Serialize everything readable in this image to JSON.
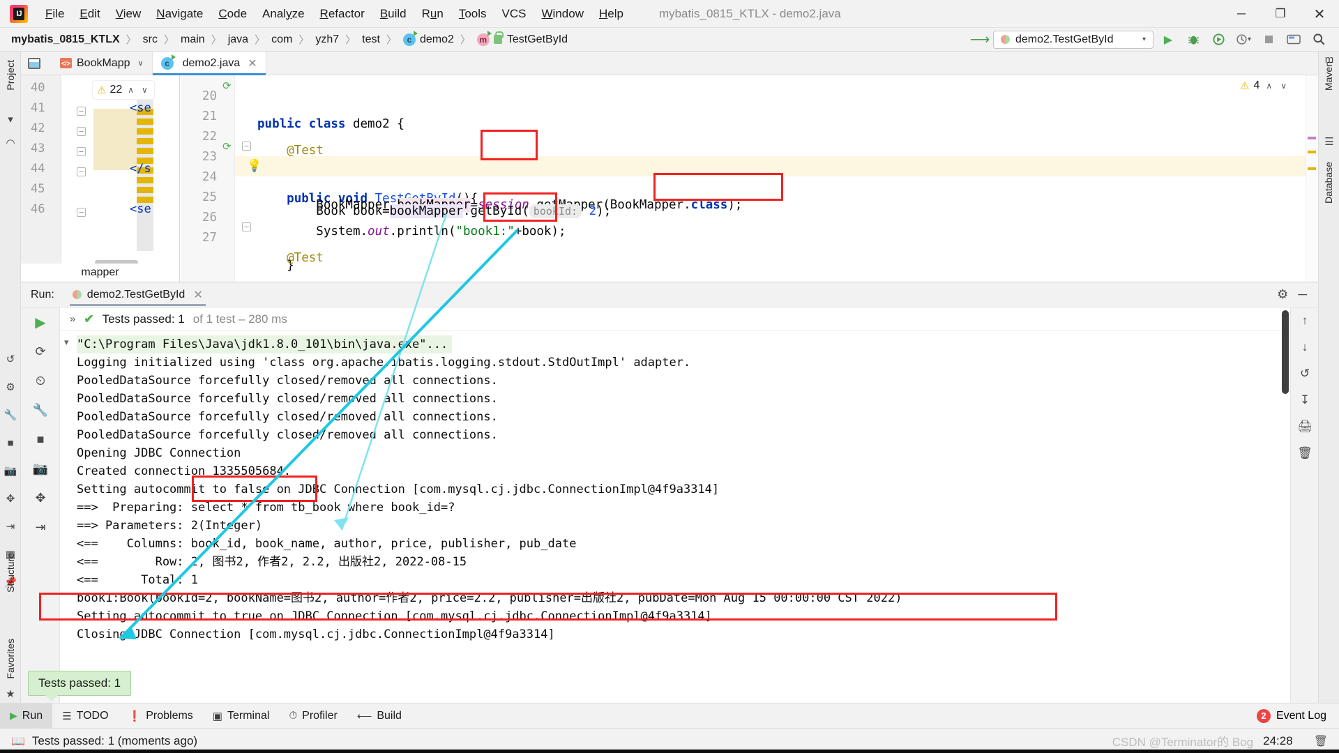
{
  "window": {
    "title": "mybatis_0815_KTLX - demo2.java",
    "minimize": "─",
    "maximize": "❐",
    "close": "✕"
  },
  "menu": {
    "items": [
      {
        "pre": "",
        "key": "F",
        "post": "ile"
      },
      {
        "pre": "",
        "key": "E",
        "post": "dit"
      },
      {
        "pre": "",
        "key": "V",
        "post": "iew"
      },
      {
        "pre": "",
        "key": "N",
        "post": "avigate"
      },
      {
        "pre": "",
        "key": "C",
        "post": "ode"
      },
      {
        "pre": "Anal",
        "key": "y",
        "post": "ze"
      },
      {
        "pre": "",
        "key": "R",
        "post": "efactor"
      },
      {
        "pre": "",
        "key": "B",
        "post": "uild"
      },
      {
        "pre": "R",
        "key": "u",
        "post": "n"
      },
      {
        "pre": "",
        "key": "T",
        "post": "ools"
      },
      {
        "pre": "VCS",
        "key": "",
        "post": ""
      },
      {
        "pre": "",
        "key": "W",
        "post": "indow"
      },
      {
        "pre": "",
        "key": "H",
        "post": "elp"
      }
    ]
  },
  "breadcrumb": {
    "items": [
      "mybatis_0815_KTLX",
      "src",
      "main",
      "java",
      "com",
      "yzh7",
      "test",
      "demo2",
      "TestGetById"
    ],
    "separator": "〉",
    "class_glyph": "c",
    "method_glyph": "m"
  },
  "toolbar": {
    "run_config": "demo2.TestGetById",
    "caret": "▾",
    "build_icon": "build-hammer",
    "run_icon": "▶",
    "debug_icon": "debug-bug",
    "coverage_icon": "run-with-coverage",
    "profile_icon": "profile",
    "stop_icon": "stop",
    "updates_icon": "updates",
    "search_icon": "🔍"
  },
  "left_strip": {
    "project_tab": "Project",
    "structure_tab": "Structure",
    "favorites_tab": "Favorites"
  },
  "right_strip": {
    "maven_tab": "Maven",
    "database_tab": "Database"
  },
  "editor": {
    "tabs": [
      {
        "label": "BookMapp",
        "icon": "xml-file-icon",
        "active": false,
        "close": "✕",
        "caret": "∨"
      },
      {
        "label": "demo2.java",
        "icon": "java-class-icon",
        "active": true,
        "close": "✕"
      }
    ],
    "ghost_pane": {
      "warning_count": "22",
      "warning_up": "∧",
      "warning_down": "∨",
      "footer_label": "mapper",
      "lines": [
        {
          "num": "40",
          "code": ""
        },
        {
          "num": "41",
          "code": "<se"
        },
        {
          "num": "42",
          "code": ""
        },
        {
          "num": "43",
          "code": ""
        },
        {
          "num": "44",
          "code": "</s"
        },
        {
          "num": "45",
          "code": ""
        },
        {
          "num": "46",
          "code": "<se"
        }
      ]
    },
    "java_pane": {
      "warning_count": "4",
      "warning_up": "∧",
      "warning_down": "∨",
      "lines": [
        {
          "num": "20",
          "text": "public class demo2 {"
        },
        {
          "num": "21",
          "text": ""
        },
        {
          "num": "22",
          "text": "    @Test"
        },
        {
          "num": "23",
          "text": "    public void TestGetById(){"
        },
        {
          "num": "24",
          "text": "        BookMapper bookMapper=session.getMapper(BookMapper.class);"
        },
        {
          "num": "25",
          "text": "        Book book=bookMapper.getById( bookId: 2);"
        },
        {
          "num": "26",
          "text": "        System.out.println(\"book1:\"+book);"
        },
        {
          "num": "27",
          "text": "    }"
        }
      ],
      "param_hint": "bookId:",
      "string_literal": "\"book1:\""
    }
  },
  "run_window": {
    "label": "Run:",
    "tab_title": "demo2.TestGetById",
    "tab_close": "✕",
    "settings_icon": "gear-icon",
    "hide_icon": "─",
    "test_status": {
      "chevrons": "»",
      "check": "✔",
      "main": "Tests passed: 1",
      "sub": "of 1 test – 280 ms"
    },
    "console_lines": [
      "\"C:\\Program Files\\Java\\jdk1.8.0_101\\bin\\java.exe\"...",
      "Logging initialized using 'class org.apache.ibatis.logging.stdout.StdOutImpl' adapter.",
      "PooledDataSource forcefully closed/removed all connections.",
      "PooledDataSource forcefully closed/removed all connections.",
      "PooledDataSource forcefully closed/removed all connections.",
      "PooledDataSource forcefully closed/removed all connections.",
      "Opening JDBC Connection",
      "Created connection 1335505684.",
      "Setting autocommit to false on JDBC Connection [com.mysql.cj.jdbc.ConnectionImpl@4f9a3314]",
      "==>  Preparing: select * from tb_book where book_id=?",
      "==> Parameters: 2(Integer)",
      "<==    Columns: book_id, book_name, author, price, publisher, pub_date",
      "<==        Row: 2, 图书2, 作者2, 2.2, 出版社2, 2022-08-15",
      "<==      Total: 1",
      "book1:Book(bookId=2, bookName=图书2, author=作者2, price=2.2, publisher=出版社2, pubDate=Mon Aug 15 00:00:00 CST 2022)",
      "Setting autocommit to true on JDBC Connection [com.mysql.cj.jdbc.ConnectionImpl@4f9a3314]",
      "Closing JDBC Connection [com.mysql.cj.jdbc.ConnectionImpl@4f9a3314]"
    ]
  },
  "tooltip": {
    "text": "Tests passed: 1"
  },
  "bottom_bar": {
    "buttons": [
      {
        "label": "Run",
        "icon": "run-icon",
        "active": true
      },
      {
        "label": "TODO",
        "icon": "todo-icon",
        "active": false
      },
      {
        "label": "Problems",
        "icon": "problems-icon",
        "active": false
      },
      {
        "label": "Terminal",
        "icon": "terminal-icon",
        "active": false
      },
      {
        "label": "Profiler",
        "icon": "profiler-icon",
        "active": false
      },
      {
        "label": "Build",
        "icon": "build-icon",
        "active": false
      }
    ],
    "event_log": {
      "label": "Event Log",
      "count": "2"
    }
  },
  "status_bar": {
    "message": "Tests passed: 1 (moments ago)",
    "watermark": "CSDN @Terminator的 Bog",
    "clock": "24:28"
  },
  "colors": {
    "accent": "#3c8fd4",
    "annotation_red": "#f02222",
    "annotation_cyan": "#1ec8e0",
    "success_green": "#4caf50",
    "warning_yellow": "#e3b505"
  }
}
